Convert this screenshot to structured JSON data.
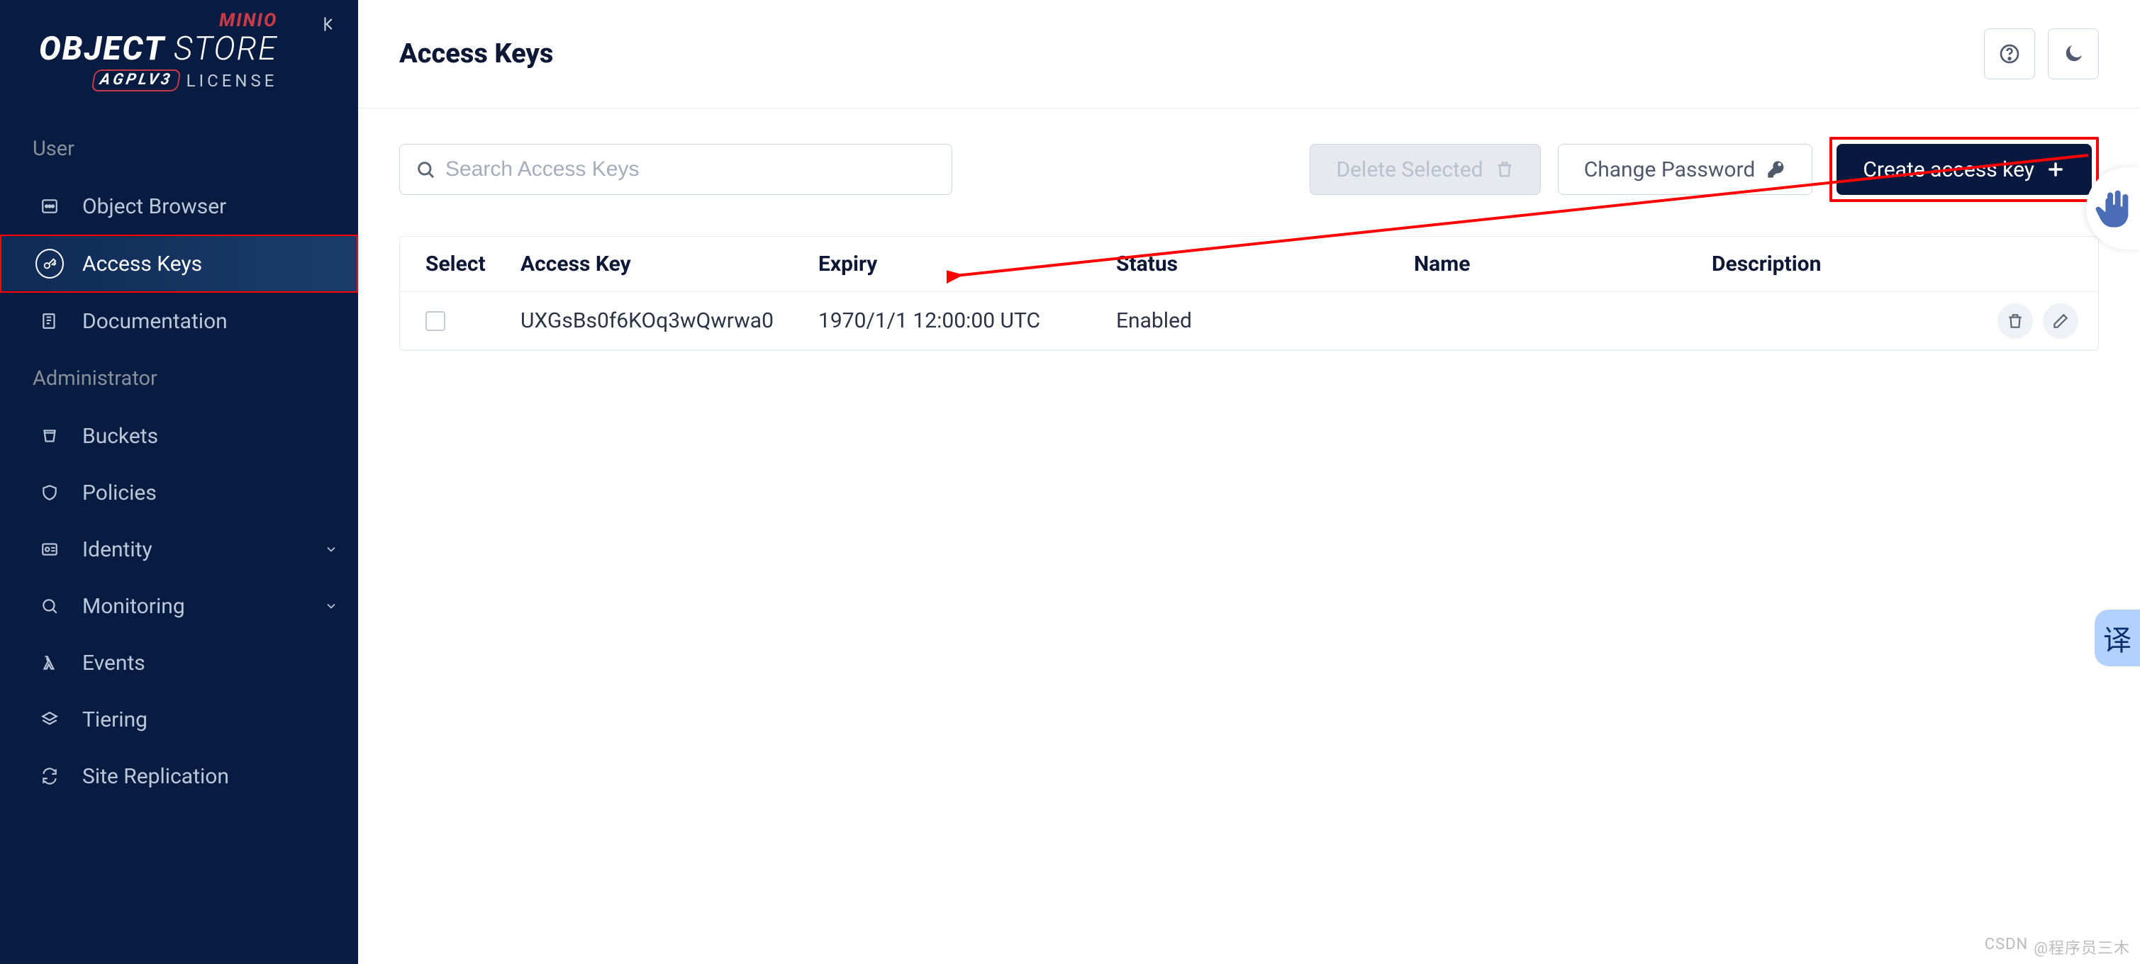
{
  "brand": {
    "vendor": "MINIO",
    "product_a": "OBJECT",
    "product_b": "STORE",
    "license_badge": "AGPLV3",
    "license_text": "LICENSE"
  },
  "sidebar": {
    "sections": {
      "0": {
        "label": "User"
      },
      "1": {
        "label": "Administrator"
      }
    },
    "items": {
      "0": {
        "label": "Object Browser"
      },
      "1": {
        "label": "Access Keys"
      },
      "2": {
        "label": "Documentation"
      },
      "3": {
        "label": "Buckets"
      },
      "4": {
        "label": "Policies"
      },
      "5": {
        "label": "Identity"
      },
      "6": {
        "label": "Monitoring"
      },
      "7": {
        "label": "Events"
      },
      "8": {
        "label": "Tiering"
      },
      "9": {
        "label": "Site Replication"
      }
    }
  },
  "header": {
    "title": "Access Keys"
  },
  "toolbar": {
    "search_placeholder": "Search Access Keys",
    "delete_label": "Delete Selected",
    "change_pw_label": "Change Password",
    "create_label": "Create access key"
  },
  "table": {
    "columns": {
      "select": "Select",
      "key": "Access Key",
      "expiry": "Expiry",
      "status": "Status",
      "name": "Name",
      "description": "Description"
    },
    "rows": {
      "0": {
        "key": "UXGsBs0f6KOq3wQwrwa0",
        "expiry": "1970/1/1 12:00:00 UTC",
        "status": "Enabled",
        "name": "",
        "description": ""
      }
    }
  },
  "float": {
    "translate_char": "译"
  },
  "watermark": {
    "site": "CSDN",
    "author": "@程序员三木"
  }
}
